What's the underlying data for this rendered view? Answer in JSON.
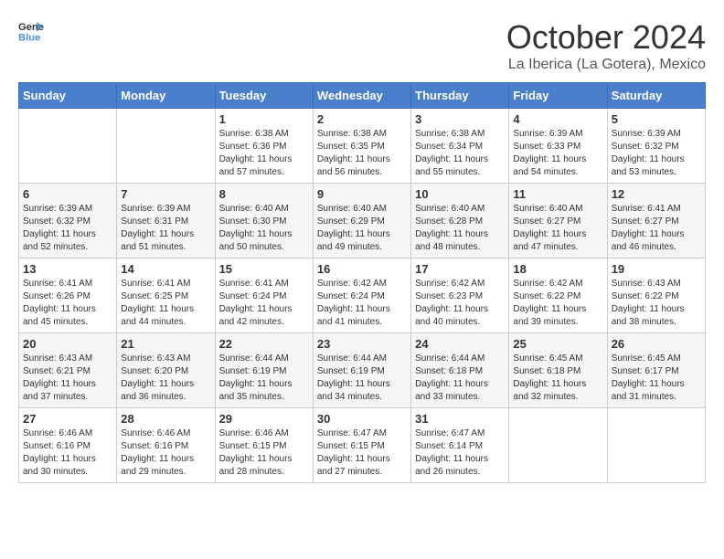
{
  "header": {
    "logo_general": "General",
    "logo_blue": "Blue",
    "month_title": "October 2024",
    "location": "La Iberica (La Gotera), Mexico"
  },
  "days_of_week": [
    "Sunday",
    "Monday",
    "Tuesday",
    "Wednesday",
    "Thursday",
    "Friday",
    "Saturday"
  ],
  "weeks": [
    [
      {
        "day": "",
        "sunrise": "",
        "sunset": "",
        "daylight": ""
      },
      {
        "day": "",
        "sunrise": "",
        "sunset": "",
        "daylight": ""
      },
      {
        "day": "1",
        "sunrise": "Sunrise: 6:38 AM",
        "sunset": "Sunset: 6:36 PM",
        "daylight": "Daylight: 11 hours and 57 minutes."
      },
      {
        "day": "2",
        "sunrise": "Sunrise: 6:38 AM",
        "sunset": "Sunset: 6:35 PM",
        "daylight": "Daylight: 11 hours and 56 minutes."
      },
      {
        "day": "3",
        "sunrise": "Sunrise: 6:38 AM",
        "sunset": "Sunset: 6:34 PM",
        "daylight": "Daylight: 11 hours and 55 minutes."
      },
      {
        "day": "4",
        "sunrise": "Sunrise: 6:39 AM",
        "sunset": "Sunset: 6:33 PM",
        "daylight": "Daylight: 11 hours and 54 minutes."
      },
      {
        "day": "5",
        "sunrise": "Sunrise: 6:39 AM",
        "sunset": "Sunset: 6:32 PM",
        "daylight": "Daylight: 11 hours and 53 minutes."
      }
    ],
    [
      {
        "day": "6",
        "sunrise": "Sunrise: 6:39 AM",
        "sunset": "Sunset: 6:32 PM",
        "daylight": "Daylight: 11 hours and 52 minutes."
      },
      {
        "day": "7",
        "sunrise": "Sunrise: 6:39 AM",
        "sunset": "Sunset: 6:31 PM",
        "daylight": "Daylight: 11 hours and 51 minutes."
      },
      {
        "day": "8",
        "sunrise": "Sunrise: 6:40 AM",
        "sunset": "Sunset: 6:30 PM",
        "daylight": "Daylight: 11 hours and 50 minutes."
      },
      {
        "day": "9",
        "sunrise": "Sunrise: 6:40 AM",
        "sunset": "Sunset: 6:29 PM",
        "daylight": "Daylight: 11 hours and 49 minutes."
      },
      {
        "day": "10",
        "sunrise": "Sunrise: 6:40 AM",
        "sunset": "Sunset: 6:28 PM",
        "daylight": "Daylight: 11 hours and 48 minutes."
      },
      {
        "day": "11",
        "sunrise": "Sunrise: 6:40 AM",
        "sunset": "Sunset: 6:27 PM",
        "daylight": "Daylight: 11 hours and 47 minutes."
      },
      {
        "day": "12",
        "sunrise": "Sunrise: 6:41 AM",
        "sunset": "Sunset: 6:27 PM",
        "daylight": "Daylight: 11 hours and 46 minutes."
      }
    ],
    [
      {
        "day": "13",
        "sunrise": "Sunrise: 6:41 AM",
        "sunset": "Sunset: 6:26 PM",
        "daylight": "Daylight: 11 hours and 45 minutes."
      },
      {
        "day": "14",
        "sunrise": "Sunrise: 6:41 AM",
        "sunset": "Sunset: 6:25 PM",
        "daylight": "Daylight: 11 hours and 44 minutes."
      },
      {
        "day": "15",
        "sunrise": "Sunrise: 6:41 AM",
        "sunset": "Sunset: 6:24 PM",
        "daylight": "Daylight: 11 hours and 42 minutes."
      },
      {
        "day": "16",
        "sunrise": "Sunrise: 6:42 AM",
        "sunset": "Sunset: 6:24 PM",
        "daylight": "Daylight: 11 hours and 41 minutes."
      },
      {
        "day": "17",
        "sunrise": "Sunrise: 6:42 AM",
        "sunset": "Sunset: 6:23 PM",
        "daylight": "Daylight: 11 hours and 40 minutes."
      },
      {
        "day": "18",
        "sunrise": "Sunrise: 6:42 AM",
        "sunset": "Sunset: 6:22 PM",
        "daylight": "Daylight: 11 hours and 39 minutes."
      },
      {
        "day": "19",
        "sunrise": "Sunrise: 6:43 AM",
        "sunset": "Sunset: 6:22 PM",
        "daylight": "Daylight: 11 hours and 38 minutes."
      }
    ],
    [
      {
        "day": "20",
        "sunrise": "Sunrise: 6:43 AM",
        "sunset": "Sunset: 6:21 PM",
        "daylight": "Daylight: 11 hours and 37 minutes."
      },
      {
        "day": "21",
        "sunrise": "Sunrise: 6:43 AM",
        "sunset": "Sunset: 6:20 PM",
        "daylight": "Daylight: 11 hours and 36 minutes."
      },
      {
        "day": "22",
        "sunrise": "Sunrise: 6:44 AM",
        "sunset": "Sunset: 6:19 PM",
        "daylight": "Daylight: 11 hours and 35 minutes."
      },
      {
        "day": "23",
        "sunrise": "Sunrise: 6:44 AM",
        "sunset": "Sunset: 6:19 PM",
        "daylight": "Daylight: 11 hours and 34 minutes."
      },
      {
        "day": "24",
        "sunrise": "Sunrise: 6:44 AM",
        "sunset": "Sunset: 6:18 PM",
        "daylight": "Daylight: 11 hours and 33 minutes."
      },
      {
        "day": "25",
        "sunrise": "Sunrise: 6:45 AM",
        "sunset": "Sunset: 6:18 PM",
        "daylight": "Daylight: 11 hours and 32 minutes."
      },
      {
        "day": "26",
        "sunrise": "Sunrise: 6:45 AM",
        "sunset": "Sunset: 6:17 PM",
        "daylight": "Daylight: 11 hours and 31 minutes."
      }
    ],
    [
      {
        "day": "27",
        "sunrise": "Sunrise: 6:46 AM",
        "sunset": "Sunset: 6:16 PM",
        "daylight": "Daylight: 11 hours and 30 minutes."
      },
      {
        "day": "28",
        "sunrise": "Sunrise: 6:46 AM",
        "sunset": "Sunset: 6:16 PM",
        "daylight": "Daylight: 11 hours and 29 minutes."
      },
      {
        "day": "29",
        "sunrise": "Sunrise: 6:46 AM",
        "sunset": "Sunset: 6:15 PM",
        "daylight": "Daylight: 11 hours and 28 minutes."
      },
      {
        "day": "30",
        "sunrise": "Sunrise: 6:47 AM",
        "sunset": "Sunset: 6:15 PM",
        "daylight": "Daylight: 11 hours and 27 minutes."
      },
      {
        "day": "31",
        "sunrise": "Sunrise: 6:47 AM",
        "sunset": "Sunset: 6:14 PM",
        "daylight": "Daylight: 11 hours and 26 minutes."
      },
      {
        "day": "",
        "sunrise": "",
        "sunset": "",
        "daylight": ""
      },
      {
        "day": "",
        "sunrise": "",
        "sunset": "",
        "daylight": ""
      }
    ]
  ]
}
